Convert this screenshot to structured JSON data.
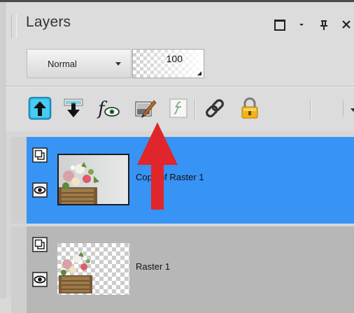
{
  "panel": {
    "title": "Layers",
    "title_icons": [
      "maximize-icon",
      "panel-menu-icon",
      "pin-icon",
      "close-icon"
    ]
  },
  "blend_mode": {
    "value": "Normal"
  },
  "opacity": {
    "value": "100"
  },
  "toolbar": {
    "buttons": [
      "move-layer-up-icon",
      "move-layer-down-icon",
      "layer-properties-icon",
      "edit-selection-icon",
      "promote-selection-icon",
      "link-icon",
      "lock-icon",
      "toolbar-overflow-icon"
    ]
  },
  "layers": [
    {
      "name": "Copy of Raster 1",
      "selected": true,
      "visible": true
    },
    {
      "name": "Raster 1",
      "selected": false,
      "visible": true
    }
  ],
  "colors": {
    "selected_row": "#3793f4",
    "annotation_arrow": "#e0262b",
    "panel_bg": "#dcdcdc"
  }
}
